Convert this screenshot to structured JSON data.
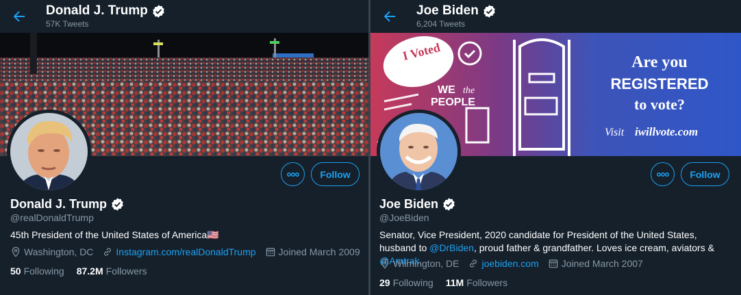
{
  "colors": {
    "background": "#15202b",
    "accent": "#1da1f2",
    "muted": "#8899a6",
    "divider": "#38444d"
  },
  "trump": {
    "title": "Donald J. Trump",
    "tweet_count": "57K Tweets",
    "name": "Donald J. Trump",
    "handle": "@realDonaldTrump",
    "bio": "45th President of the United States of America",
    "bio_flag": "🇺🇸",
    "location": "Washington, DC",
    "website": "Instagram.com/realDonaldTrump",
    "joined": "Joined March 2009",
    "following_count": "50",
    "following_label": "Following",
    "followers_count": "87.2M",
    "followers_label": "Followers",
    "follow_label": "Follow",
    "icons": {
      "back": "back-arrow-icon",
      "verified": "verified-badge-icon",
      "more": "more-dots-icon",
      "location": "location-pin-icon",
      "link": "link-icon",
      "calendar": "calendar-icon"
    }
  },
  "biden": {
    "title": "Joe Biden",
    "tweet_count": "6,204 Tweets",
    "name": "Joe Biden",
    "handle": "@JoeBiden",
    "bio_text_1": "Senator, Vice President, 2020 candidate for President of the United States, husband to ",
    "bio_mention_1": "@DrBiden",
    "bio_text_2": ", proud father & grandfather. Loves ice cream, aviators & ",
    "bio_mention_2": "@Amtrak",
    "location": "Wilmington, DE",
    "website": "joebiden.com",
    "joined": "Joined March 2007",
    "following_count": "29",
    "following_label": "Following",
    "followers_count": "11M",
    "followers_label": "Followers",
    "follow_label": "Follow",
    "banner": {
      "sticker": "I Voted",
      "we_the": "WE",
      "the": "the",
      "people": "PEOPLE",
      "line1": "Are you",
      "line2": "REGISTERED",
      "line3": "to vote?",
      "visit": "Visit",
      "url": "iwillvote.com"
    }
  }
}
